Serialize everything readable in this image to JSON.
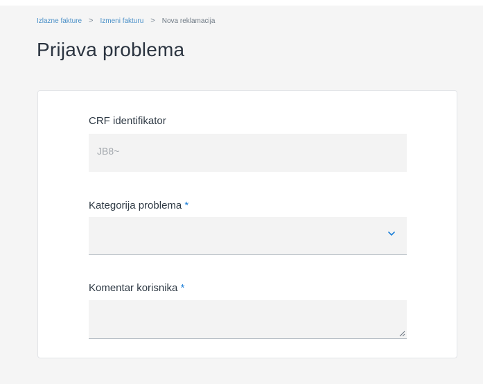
{
  "breadcrumb": {
    "items": [
      "Izlazne fakture",
      "Izmeni fakturu",
      "Nova reklamacija"
    ],
    "separator": ">"
  },
  "page": {
    "title": "Prijava problema"
  },
  "form": {
    "crf": {
      "label": "CRF identifikator",
      "value": "JB8~"
    },
    "category": {
      "label": "Kategorija problema",
      "required_mark": "*",
      "value": "",
      "icon": "chevron-down-icon"
    },
    "comment": {
      "label": "Komentar korisnika",
      "required_mark": "*",
      "value": "",
      "icon": "resize-handle-icon"
    }
  },
  "colors": {
    "accent": "#1e80d8",
    "breadcrumb_link": "#4a90c8",
    "title": "#2b3440",
    "field_background": "#f3f3f3",
    "page_background": "#f5f5f5"
  }
}
